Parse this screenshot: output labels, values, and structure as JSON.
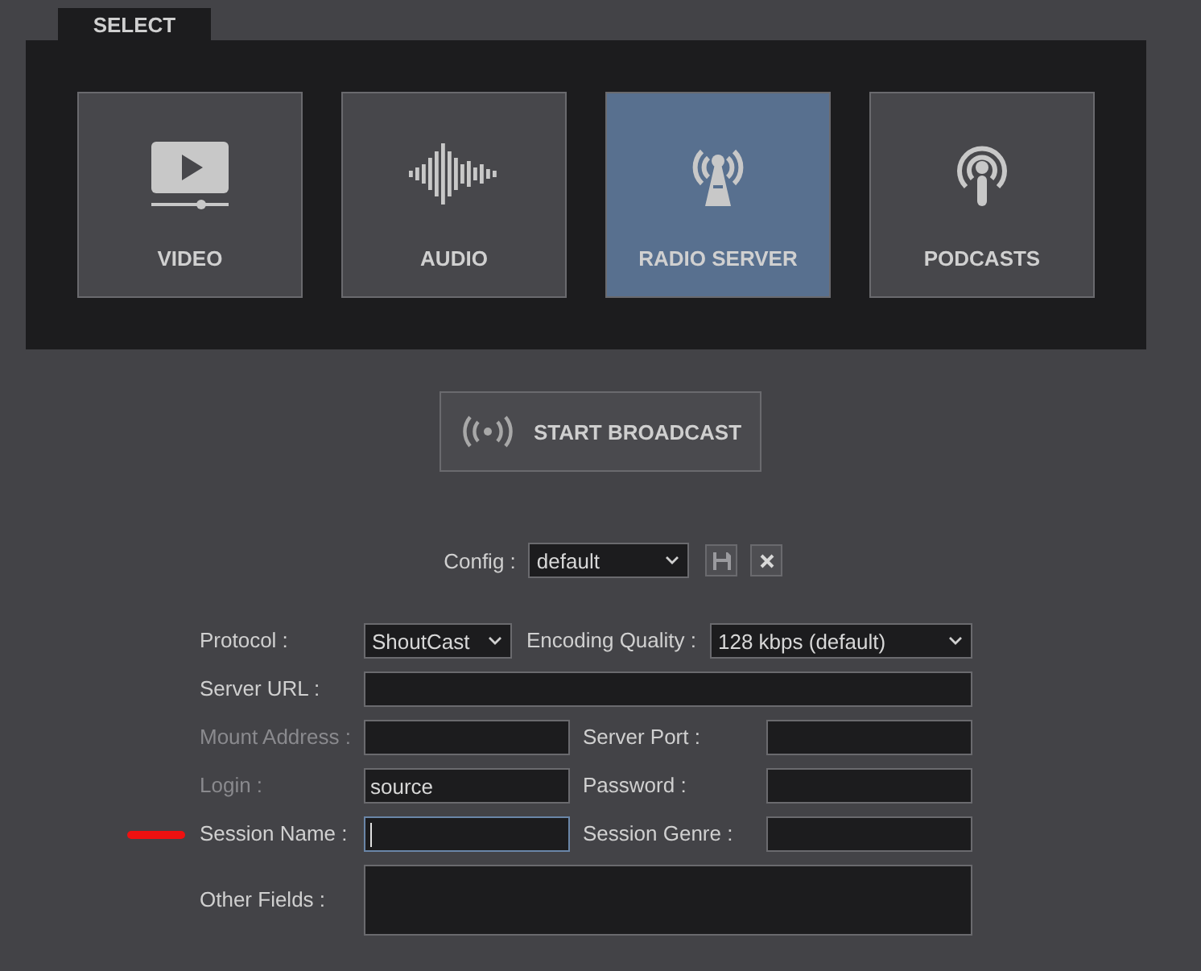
{
  "select_tab": {
    "label": "SELECT"
  },
  "sources": [
    {
      "label": "VIDEO",
      "kind": "video",
      "selected": false
    },
    {
      "label": "AUDIO",
      "kind": "audio",
      "selected": false
    },
    {
      "label": "RADIO SERVER",
      "kind": "radio",
      "selected": true
    },
    {
      "label": "PODCASTS",
      "kind": "podcast",
      "selected": false
    }
  ],
  "broadcast_button": {
    "label": "START BROADCAST"
  },
  "config": {
    "label": "Config :",
    "value": "default"
  },
  "form_rows": [
    {
      "kind": "selects",
      "marked": false,
      "fields": [
        {
          "label": "Protocol :",
          "value": "ShoutCast",
          "disabled": false
        },
        {
          "label": "Encoding Quality :",
          "value": "128 kbps (default)",
          "disabled": false
        }
      ]
    },
    {
      "kind": "wide",
      "marked": false,
      "fields": [
        {
          "label": "Server URL :",
          "disabled": false,
          "focused": false
        }
      ]
    },
    {
      "kind": "pair",
      "marked": false,
      "fields": [
        {
          "label": "Mount Address :",
          "disabled": true,
          "focused": false
        },
        {
          "label": "Server Port :",
          "disabled": false,
          "focused": false
        }
      ]
    },
    {
      "kind": "pair",
      "marked": false,
      "fields": [
        {
          "label": "Login :",
          "value": "source",
          "disabled": true,
          "focused": false
        },
        {
          "label": "Password :",
          "disabled": false,
          "focused": false
        }
      ]
    },
    {
      "kind": "pair",
      "marked": true,
      "fields": [
        {
          "label": "Session Name :",
          "disabled": false,
          "focused": true
        },
        {
          "label": "Session Genre :",
          "disabled": false,
          "focused": false
        }
      ]
    },
    {
      "kind": "textarea",
      "marked": false,
      "fields": [
        {
          "label": "Other Fields :",
          "disabled": false,
          "focused": false
        }
      ]
    }
  ]
}
